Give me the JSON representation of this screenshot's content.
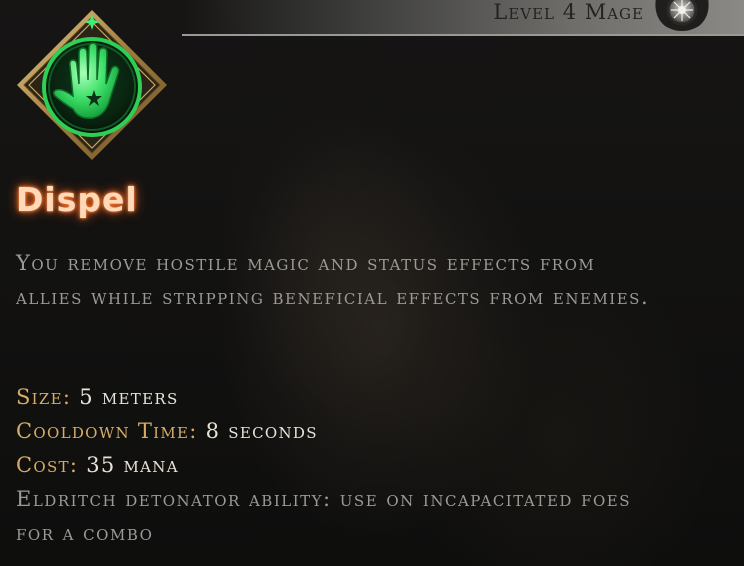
{
  "header": {
    "level_text": "Level 4 Mage",
    "class_emblem_icon": "mage-emblem-icon"
  },
  "ability": {
    "icon": "dispel-hand-icon",
    "name": "Dispel",
    "description": "You remove hostile magic and status effects from allies while stripping beneficial effects from enemies."
  },
  "stats": [
    {
      "label": "Size:",
      "value": "5 meters"
    },
    {
      "label": "Cooldown Time:",
      "value": "8 seconds"
    },
    {
      "label": "Cost:",
      "value": "35 mana"
    }
  ],
  "note": "Eldritch detonator ability: use on incapacitated foes for a combo",
  "colors": {
    "name_glow": "#ff7a2e",
    "stat_label": "#d6ad67",
    "body_text": "#9c9a95",
    "icon_green": "#2ecf55",
    "icon_frame_gold": "#c9a45c"
  }
}
